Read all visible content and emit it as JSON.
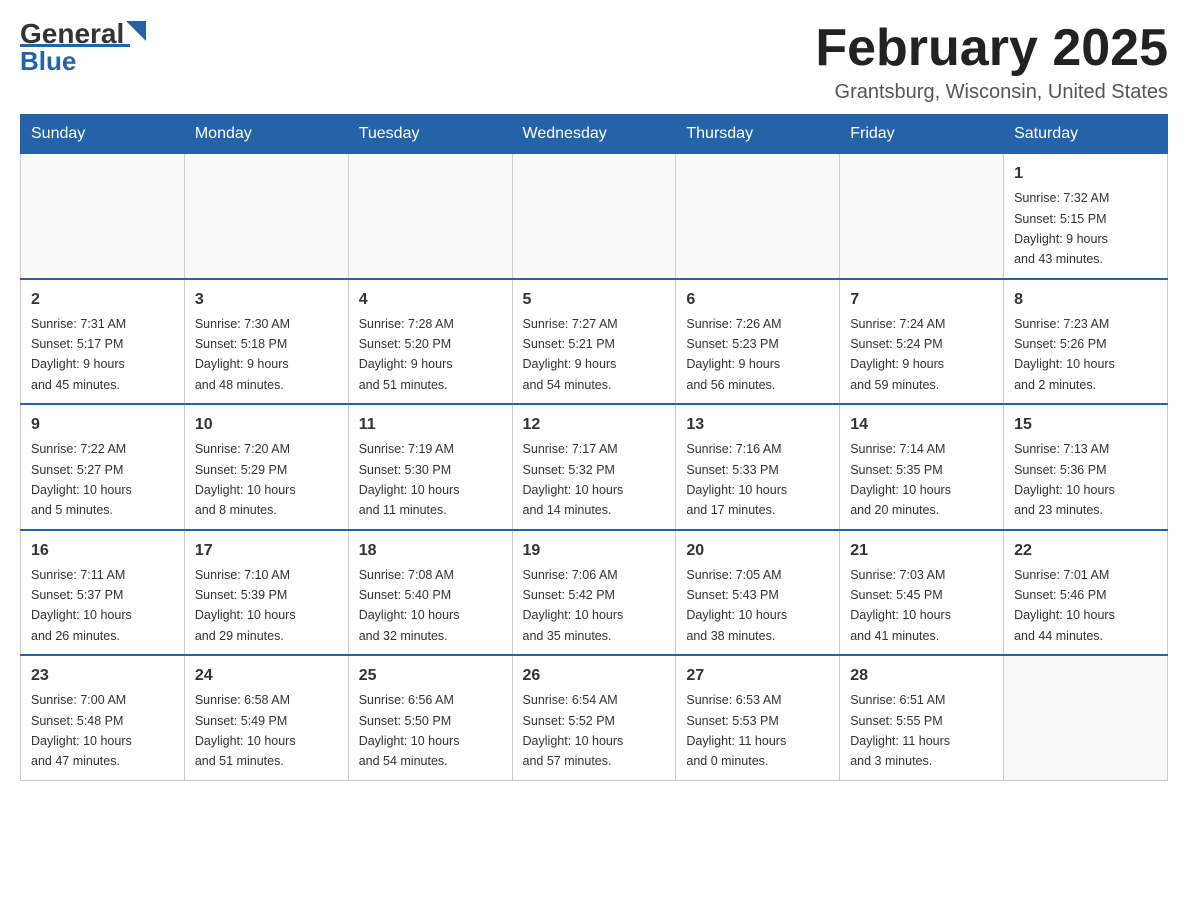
{
  "header": {
    "logo_general": "General",
    "logo_blue": "Blue",
    "title": "February 2025",
    "subtitle": "Grantsburg, Wisconsin, United States"
  },
  "weekdays": [
    "Sunday",
    "Monday",
    "Tuesday",
    "Wednesday",
    "Thursday",
    "Friday",
    "Saturday"
  ],
  "weeks": [
    [
      {
        "day": "",
        "info": ""
      },
      {
        "day": "",
        "info": ""
      },
      {
        "day": "",
        "info": ""
      },
      {
        "day": "",
        "info": ""
      },
      {
        "day": "",
        "info": ""
      },
      {
        "day": "",
        "info": ""
      },
      {
        "day": "1",
        "info": "Sunrise: 7:32 AM\nSunset: 5:15 PM\nDaylight: 9 hours\nand 43 minutes."
      }
    ],
    [
      {
        "day": "2",
        "info": "Sunrise: 7:31 AM\nSunset: 5:17 PM\nDaylight: 9 hours\nand 45 minutes."
      },
      {
        "day": "3",
        "info": "Sunrise: 7:30 AM\nSunset: 5:18 PM\nDaylight: 9 hours\nand 48 minutes."
      },
      {
        "day": "4",
        "info": "Sunrise: 7:28 AM\nSunset: 5:20 PM\nDaylight: 9 hours\nand 51 minutes."
      },
      {
        "day": "5",
        "info": "Sunrise: 7:27 AM\nSunset: 5:21 PM\nDaylight: 9 hours\nand 54 minutes."
      },
      {
        "day": "6",
        "info": "Sunrise: 7:26 AM\nSunset: 5:23 PM\nDaylight: 9 hours\nand 56 minutes."
      },
      {
        "day": "7",
        "info": "Sunrise: 7:24 AM\nSunset: 5:24 PM\nDaylight: 9 hours\nand 59 minutes."
      },
      {
        "day": "8",
        "info": "Sunrise: 7:23 AM\nSunset: 5:26 PM\nDaylight: 10 hours\nand 2 minutes."
      }
    ],
    [
      {
        "day": "9",
        "info": "Sunrise: 7:22 AM\nSunset: 5:27 PM\nDaylight: 10 hours\nand 5 minutes."
      },
      {
        "day": "10",
        "info": "Sunrise: 7:20 AM\nSunset: 5:29 PM\nDaylight: 10 hours\nand 8 minutes."
      },
      {
        "day": "11",
        "info": "Sunrise: 7:19 AM\nSunset: 5:30 PM\nDaylight: 10 hours\nand 11 minutes."
      },
      {
        "day": "12",
        "info": "Sunrise: 7:17 AM\nSunset: 5:32 PM\nDaylight: 10 hours\nand 14 minutes."
      },
      {
        "day": "13",
        "info": "Sunrise: 7:16 AM\nSunset: 5:33 PM\nDaylight: 10 hours\nand 17 minutes."
      },
      {
        "day": "14",
        "info": "Sunrise: 7:14 AM\nSunset: 5:35 PM\nDaylight: 10 hours\nand 20 minutes."
      },
      {
        "day": "15",
        "info": "Sunrise: 7:13 AM\nSunset: 5:36 PM\nDaylight: 10 hours\nand 23 minutes."
      }
    ],
    [
      {
        "day": "16",
        "info": "Sunrise: 7:11 AM\nSunset: 5:37 PM\nDaylight: 10 hours\nand 26 minutes."
      },
      {
        "day": "17",
        "info": "Sunrise: 7:10 AM\nSunset: 5:39 PM\nDaylight: 10 hours\nand 29 minutes."
      },
      {
        "day": "18",
        "info": "Sunrise: 7:08 AM\nSunset: 5:40 PM\nDaylight: 10 hours\nand 32 minutes."
      },
      {
        "day": "19",
        "info": "Sunrise: 7:06 AM\nSunset: 5:42 PM\nDaylight: 10 hours\nand 35 minutes."
      },
      {
        "day": "20",
        "info": "Sunrise: 7:05 AM\nSunset: 5:43 PM\nDaylight: 10 hours\nand 38 minutes."
      },
      {
        "day": "21",
        "info": "Sunrise: 7:03 AM\nSunset: 5:45 PM\nDaylight: 10 hours\nand 41 minutes."
      },
      {
        "day": "22",
        "info": "Sunrise: 7:01 AM\nSunset: 5:46 PM\nDaylight: 10 hours\nand 44 minutes."
      }
    ],
    [
      {
        "day": "23",
        "info": "Sunrise: 7:00 AM\nSunset: 5:48 PM\nDaylight: 10 hours\nand 47 minutes."
      },
      {
        "day": "24",
        "info": "Sunrise: 6:58 AM\nSunset: 5:49 PM\nDaylight: 10 hours\nand 51 minutes."
      },
      {
        "day": "25",
        "info": "Sunrise: 6:56 AM\nSunset: 5:50 PM\nDaylight: 10 hours\nand 54 minutes."
      },
      {
        "day": "26",
        "info": "Sunrise: 6:54 AM\nSunset: 5:52 PM\nDaylight: 10 hours\nand 57 minutes."
      },
      {
        "day": "27",
        "info": "Sunrise: 6:53 AM\nSunset: 5:53 PM\nDaylight: 11 hours\nand 0 minutes."
      },
      {
        "day": "28",
        "info": "Sunrise: 6:51 AM\nSunset: 5:55 PM\nDaylight: 11 hours\nand 3 minutes."
      },
      {
        "day": "",
        "info": ""
      }
    ]
  ]
}
